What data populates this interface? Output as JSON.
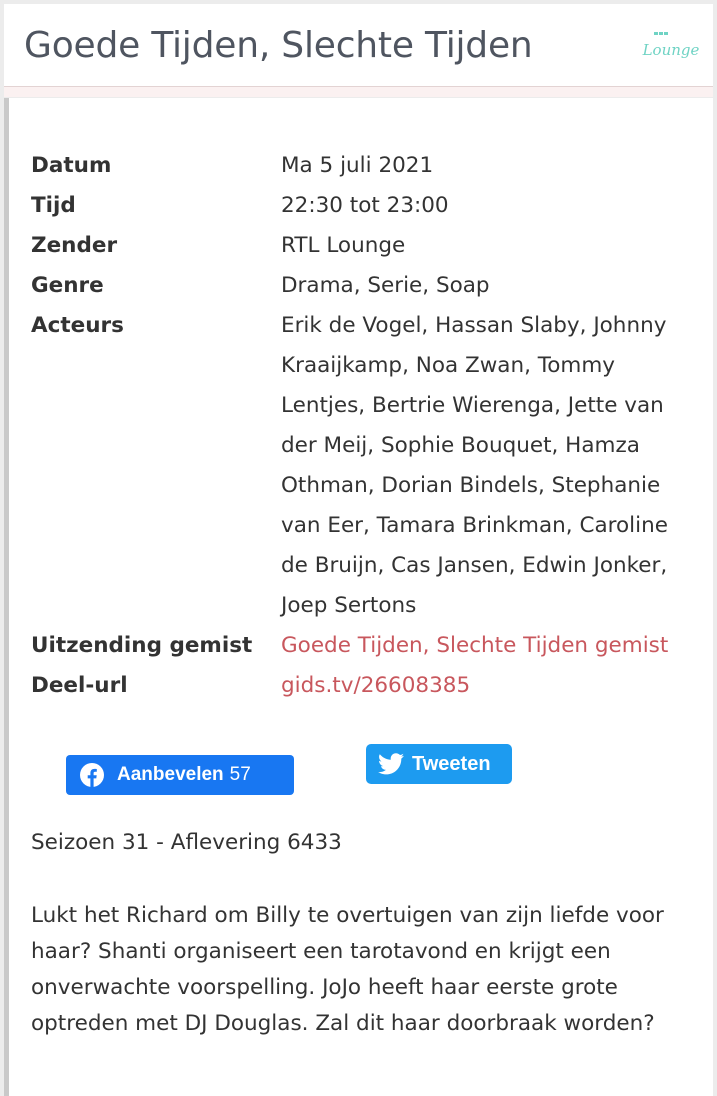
{
  "header": {
    "title": "Goede Tijden, Slechte Tijden",
    "channel_logo": {
      "icon": "rtl-lounge-logo",
      "text": "Lounge",
      "color": "#6fd3c4"
    }
  },
  "details": {
    "rows": [
      {
        "label": "Datum",
        "value": "Ma 5 juli 2021"
      },
      {
        "label": "Tijd",
        "value": "22:30 tot 23:00"
      },
      {
        "label": "Zender",
        "value": "RTL Lounge"
      },
      {
        "label": "Genre",
        "value": "Drama, Serie, Soap"
      },
      {
        "label": "Acteurs",
        "value": "Erik de Vogel, Hassan Slaby, Johnny Kraaijkamp, Noa Zwan, Tommy Lentjes, Bertrie Wierenga, Jette van der Meij, Sophie Bouquet, Hamza Othman, Dorian Bindels, Stephanie van Eer, Tamara Brinkman, Caroline de Bruijn, Cas Jansen, Edwin Jonker, Joep Sertons"
      }
    ],
    "missed": {
      "label": "Uitzending gemist",
      "link_text": "Goede Tijden, Slechte Tijden gemist"
    },
    "share_url": {
      "label": "Deel-url",
      "link_text": "gids.tv/26608385"
    },
    "link_color": "#c8575d"
  },
  "social": {
    "facebook": {
      "label": "Aanbevelen",
      "count": "57",
      "icon": "facebook-icon",
      "color": "#1877f2"
    },
    "twitter": {
      "label": "Tweeten",
      "icon": "twitter-bird-icon",
      "color": "#1d9bf0"
    }
  },
  "episode": "Seizoen 31 - Aflevering 6433",
  "description": "Lukt het Richard om Billy te overtuigen van zijn liefde voor haar? Shanti organiseert een tarotavond en krijgt een onverwachte voorspelling. JoJo heeft haar eerste grote optreden met DJ Douglas. Zal dit haar doorbraak worden?"
}
